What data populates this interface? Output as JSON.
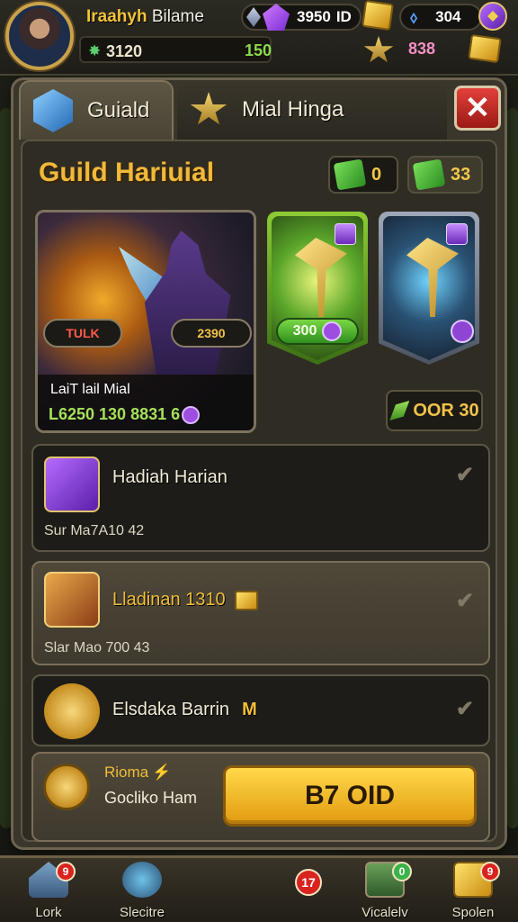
{
  "hud": {
    "player_name": "Iraahyh",
    "player_name_suffix": "Bilame",
    "gems": "3950",
    "gems_suffix": "ID",
    "energy": "304",
    "power": "3120",
    "level": "150",
    "pink_value": "838"
  },
  "tabs": [
    {
      "label": "Guiald",
      "icon": "hexagon-gem-icon"
    },
    {
      "label": "Mial Hinga",
      "icon": "star-pin-icon"
    }
  ],
  "title": "Guild Hariuial",
  "resources": [
    {
      "value": "0",
      "icon": "green-cube-icon"
    },
    {
      "value": "33",
      "icon": "green-cube-icon"
    }
  ],
  "hero_card": {
    "tag_left": "TULK",
    "tag_right": "2390",
    "name": "LaiT lail Mial",
    "stats": "L6250 130 8831 6"
  },
  "weapon_price": "300",
  "collect_value": "OOR 30",
  "rows": [
    {
      "title": "Hadiah Harian",
      "sub": "Sur Ma7A10 42",
      "icon": "chest-icon"
    },
    {
      "title": "Lladinan 1310",
      "sub": "Slar Mao 700 43",
      "icon": "helmet-icon"
    },
    {
      "title": "Elsdaka Barrin",
      "suffix": "M",
      "icon": "sun-medal-icon"
    }
  ],
  "bonus": {
    "label": "Rioma",
    "sub": "Gocliko Ham"
  },
  "claim_button": "B7 OID",
  "nav": [
    {
      "label": "Lork",
      "badge": "9"
    },
    {
      "label": "Slecitre",
      "badge": ""
    },
    {
      "label": "",
      "badge": "17"
    },
    {
      "label": "Vicalelv",
      "badge": "0"
    },
    {
      "label": "Spolen",
      "badge": "9"
    }
  ],
  "colors": {
    "gold": "#f0bd3a",
    "panel": "#3a362b",
    "claim": "#ffd94a",
    "close": "#e3403a"
  }
}
